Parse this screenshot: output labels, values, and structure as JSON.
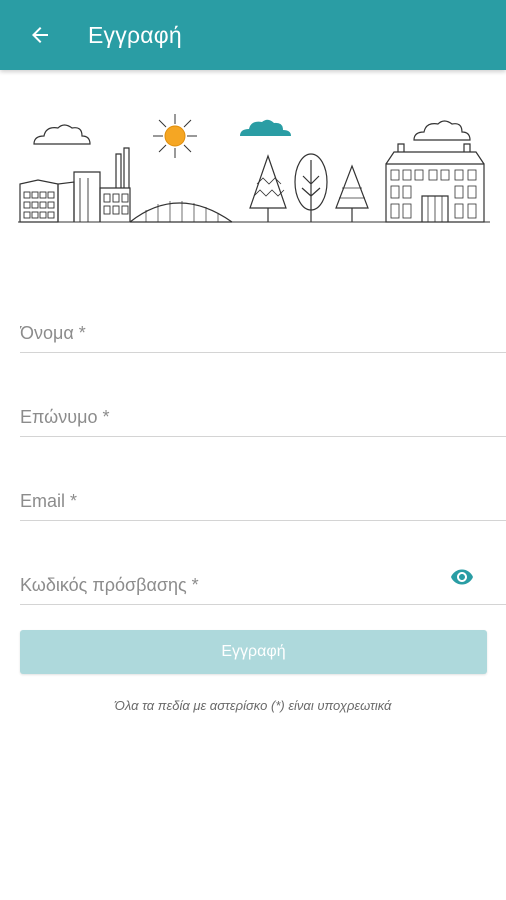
{
  "header": {
    "title": "Εγγραφή",
    "back_icon": "arrow-left-icon"
  },
  "illustration": {
    "icon": "city-landscape-illustration",
    "accent_color": "#2a9da4",
    "sun_color": "#f5a623"
  },
  "form": {
    "first_name": {
      "placeholder": "Όνομα *",
      "value": ""
    },
    "last_name": {
      "placeholder": "Επώνυμο *",
      "value": ""
    },
    "email": {
      "placeholder": "Email *",
      "value": ""
    },
    "password": {
      "placeholder": "Κωδικός πρόσβασης *",
      "value": "",
      "toggle_icon": "eye-icon"
    },
    "submit_label": "Εγγραφή",
    "required_note": "Όλα τα πεδία με αστερίσκο (*) είναι υποχρεωτικά"
  },
  "colors": {
    "primary": "#2a9da4",
    "button_disabled": "#aed9dc"
  }
}
